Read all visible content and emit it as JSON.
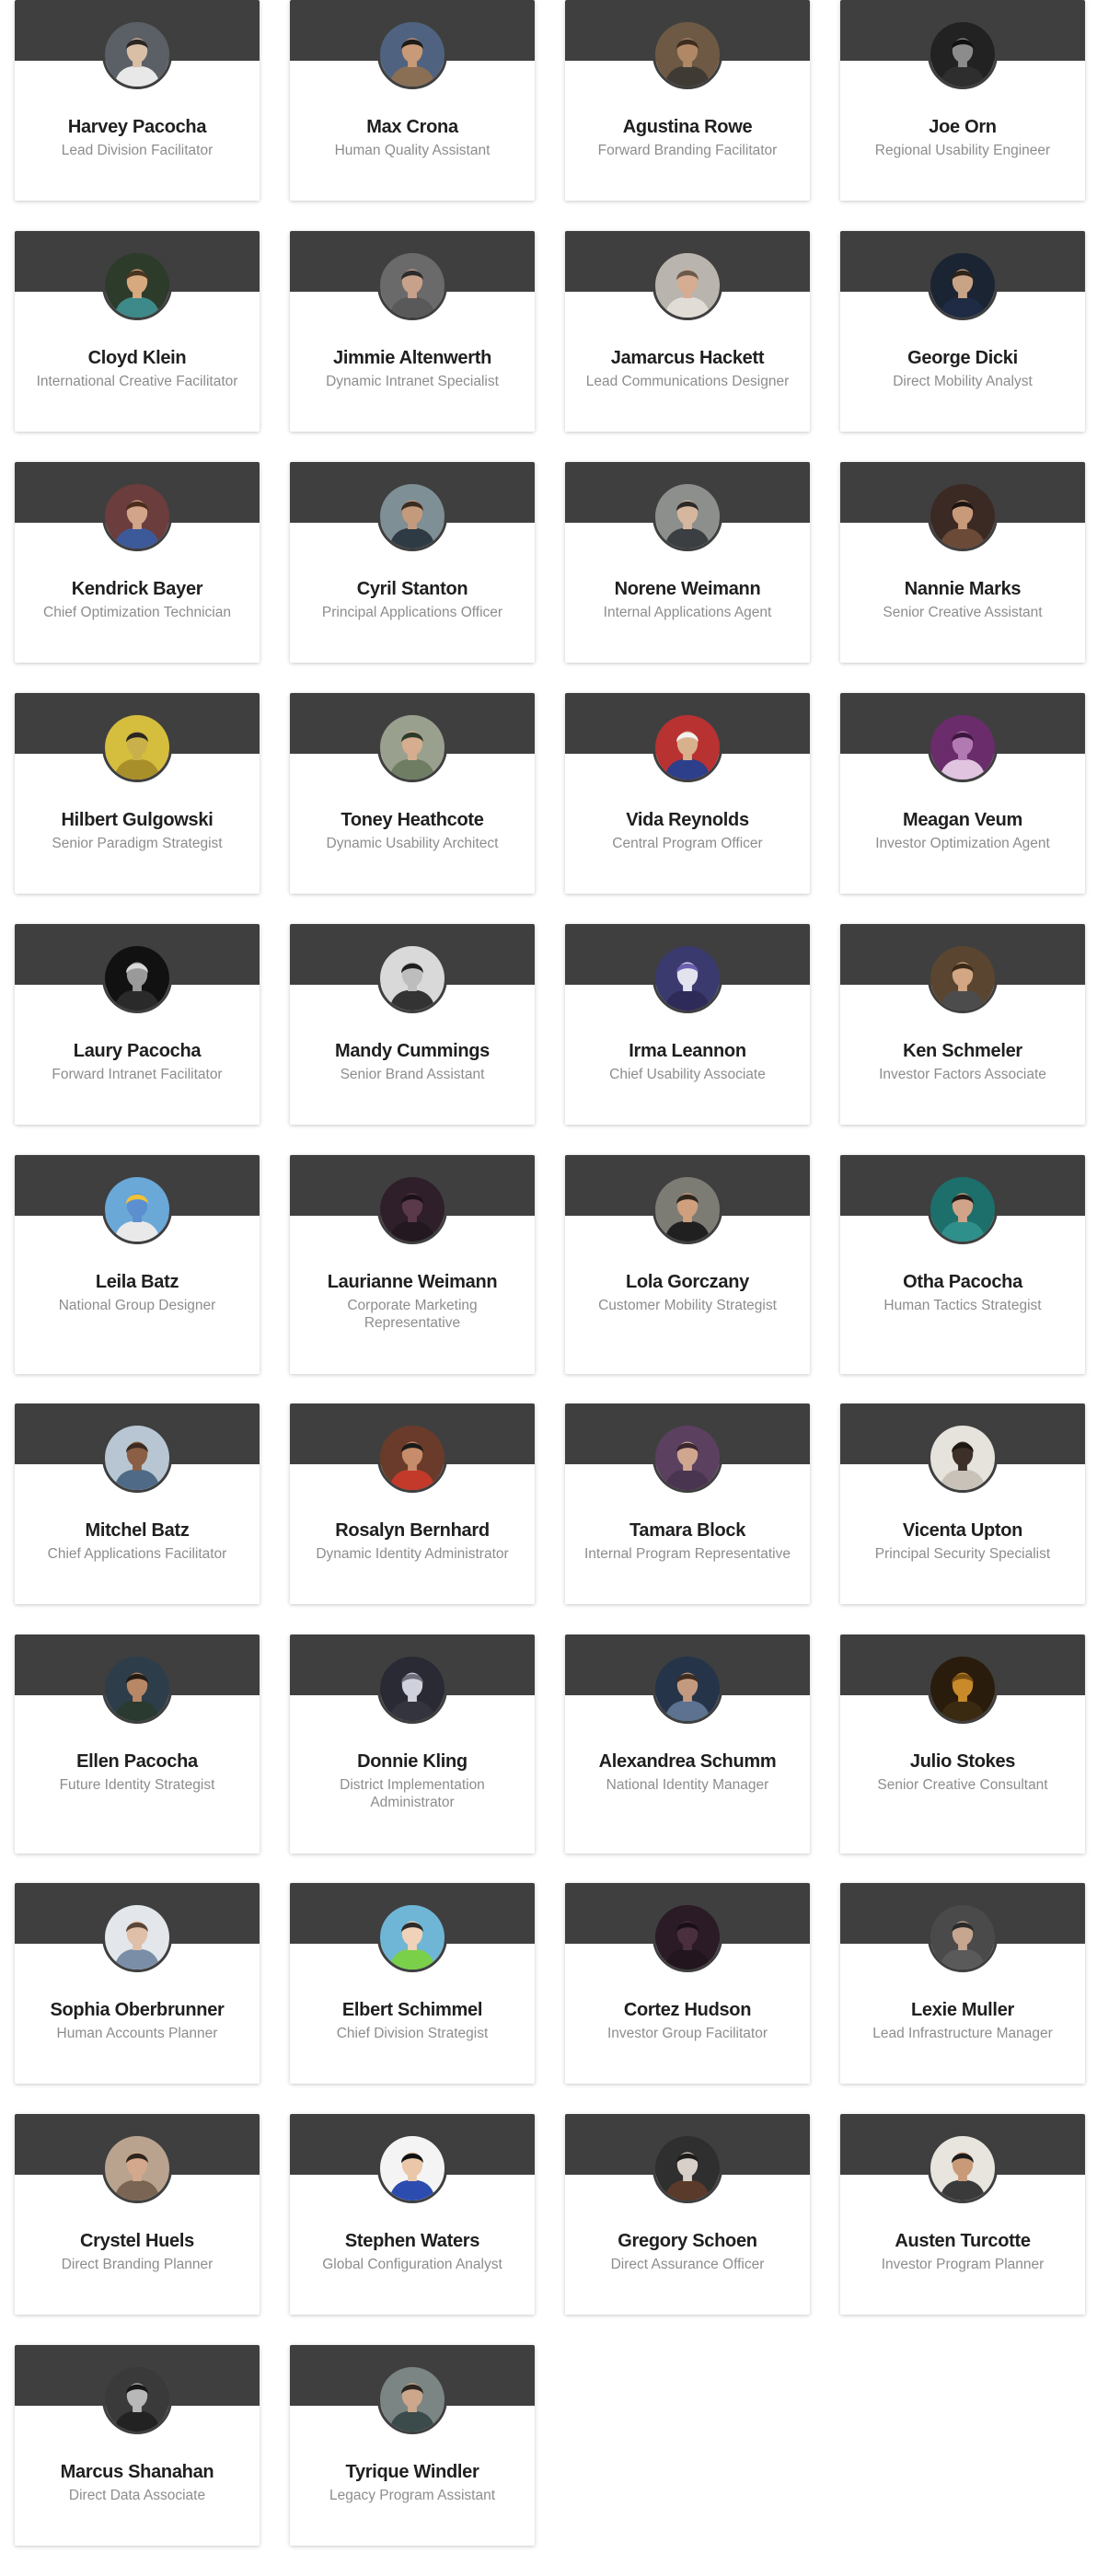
{
  "accent_colors": {
    "card_header": "#3f3f3f",
    "name_text": "#1f1f1f",
    "title_text": "#8d8d8d",
    "card_background": "#ffffff"
  },
  "people": [
    {
      "name": "Harvey Pacocha",
      "title": "Lead Division Facilitator",
      "avatar": {
        "bg": "#5b6066",
        "skin": "#d9bfa6",
        "hair": "#2a2523",
        "shirt": "#e8e8e8"
      }
    },
    {
      "name": "Max Crona",
      "title": "Human Quality Assistant",
      "avatar": {
        "bg": "#4f6380",
        "skin": "#c89a78",
        "hair": "#1d1a18",
        "shirt": "#8a6f55"
      }
    },
    {
      "name": "Agustina Rowe",
      "title": "Forward Branding Facilitator",
      "avatar": {
        "bg": "#6e5a44",
        "skin": "#b08866",
        "hair": "#3d2c1f",
        "shirt": "#403a34"
      }
    },
    {
      "name": "Joe Orn",
      "title": "Regional Usability Engineer",
      "avatar": {
        "bg": "#222222",
        "skin": "#8c8c8c",
        "hair": "#111111",
        "shirt": "#2e2e2e"
      }
    },
    {
      "name": "Cloyd Klein",
      "title": "International Creative Facilitator",
      "avatar": {
        "bg": "#2d3b2a",
        "skin": "#d7a97f",
        "hair": "#4a3422",
        "shirt": "#3e8a8a"
      }
    },
    {
      "name": "Jimmie Altenwerth",
      "title": "Dynamic Intranet Specialist",
      "avatar": {
        "bg": "#6a6a6a",
        "skin": "#c7a18a",
        "hair": "#2b2b2b",
        "shirt": "#595959"
      }
    },
    {
      "name": "Jamarcus Hackett",
      "title": "Lead Communications Designer",
      "avatar": {
        "bg": "#b9b4ad",
        "skin": "#d6ad92",
        "hair": "#6b5a4c",
        "shirt": "#e1dcd6"
      }
    },
    {
      "name": "George Dicki",
      "title": "Direct Mobility Analyst",
      "avatar": {
        "bg": "#1b2433",
        "skin": "#c9a386",
        "hair": "#2d2419",
        "shirt": "#1f2b44"
      }
    },
    {
      "name": "Kendrick Bayer",
      "title": "Chief Optimization Technician",
      "avatar": {
        "bg": "#6b3d3d",
        "skin": "#d2a48a",
        "hair": "#4a2d1c",
        "shirt": "#3c5a9a"
      }
    },
    {
      "name": "Cyril Stanton",
      "title": "Principal Applications Officer",
      "avatar": {
        "bg": "#7e8f95",
        "skin": "#c49a7c",
        "hair": "#3b2b21",
        "shirt": "#2f3b44"
      }
    },
    {
      "name": "Norene Weimann",
      "title": "Internal Applications Agent",
      "avatar": {
        "bg": "#8c8f8c",
        "skin": "#d6b69e",
        "hair": "#2c2a28",
        "shirt": "#3b3f42"
      }
    },
    {
      "name": "Nannie Marks",
      "title": "Senior Creative Assistant",
      "avatar": {
        "bg": "#3b2a24",
        "skin": "#c99a7a",
        "hair": "#1a1412",
        "shirt": "#6b4a38"
      }
    },
    {
      "name": "Hilbert Gulgowski",
      "title": "Senior Paradigm Strategist",
      "avatar": {
        "bg": "#d5bd3e",
        "skin": "#c9b04a",
        "hair": "#2a2620",
        "shirt": "#a98f2a"
      }
    },
    {
      "name": "Toney Heathcote",
      "title": "Dynamic Usability Architect",
      "avatar": {
        "bg": "#9aa08e",
        "skin": "#d6ad8f",
        "hair": "#2c3a2a",
        "shirt": "#6f7d63"
      }
    },
    {
      "name": "Vida Reynolds",
      "title": "Central Program Officer",
      "avatar": {
        "bg": "#b83232",
        "skin": "#d8b08c",
        "hair": "#f2f2f2",
        "shirt": "#2d3f8a"
      }
    },
    {
      "name": "Meagan Veum",
      "title": "Investor Optimization Agent",
      "avatar": {
        "bg": "#6a2c6a",
        "skin": "#b27ab2",
        "hair": "#3d163d",
        "shirt": "#e0c4e0"
      }
    },
    {
      "name": "Laury Pacocha",
      "title": "Forward Intranet Facilitator",
      "avatar": {
        "bg": "#111111",
        "skin": "#9a9a9a",
        "hair": "#d8d8d8",
        "shirt": "#2a2a2a"
      }
    },
    {
      "name": "Mandy Cummings",
      "title": "Senior Brand Assistant",
      "avatar": {
        "bg": "#d9d9d9",
        "skin": "#bdbdbd",
        "hair": "#1e1e1e",
        "shirt": "#333333"
      }
    },
    {
      "name": "Irma Leannon",
      "title": "Chief Usability Associate",
      "avatar": {
        "bg": "#3b3a6e",
        "skin": "#e3e3ef",
        "hair": "#6a5fb0",
        "shirt": "#2e2b58"
      }
    },
    {
      "name": "Ken Schmeler",
      "title": "Investor Factors Associate",
      "avatar": {
        "bg": "#5a4630",
        "skin": "#d3a784",
        "hair": "#3a2a1a",
        "shirt": "#4c4c4c"
      }
    },
    {
      "name": "Leila Batz",
      "title": "National Group Designer",
      "avatar": {
        "bg": "#6aa8d8",
        "skin": "#5b8fd0",
        "hair": "#f0c23a",
        "shirt": "#e9e9e9"
      }
    },
    {
      "name": "Laurianne Weimann",
      "title": "Corporate Marketing Representative",
      "avatar": {
        "bg": "#2e1f2a",
        "skin": "#5a3a4a",
        "hair": "#1b1218",
        "shirt": "#241820"
      }
    },
    {
      "name": "Lola Gorczany",
      "title": "Customer Mobility Strategist",
      "avatar": {
        "bg": "#7d7c74",
        "skin": "#cf9f7e",
        "hair": "#2d241d",
        "shirt": "#202020"
      }
    },
    {
      "name": "Otha Pacocha",
      "title": "Human Tactics Strategist",
      "avatar": {
        "bg": "#1c6f6a",
        "skin": "#d1a489",
        "hair": "#241b17",
        "shirt": "#2f8f8a"
      }
    },
    {
      "name": "Mitchel Batz",
      "title": "Chief Applications Facilitator",
      "avatar": {
        "bg": "#b7c6d2",
        "skin": "#8a5f45",
        "hair": "#3b2a20",
        "shirt": "#4e6a86"
      }
    },
    {
      "name": "Rosalyn Bernhard",
      "title": "Dynamic Identity Administrator",
      "avatar": {
        "bg": "#6a3b2a",
        "skin": "#c78c6a",
        "hair": "#1a1a1a",
        "shirt": "#c33a2b"
      }
    },
    {
      "name": "Tamara Block",
      "title": "Internal Program Representative",
      "avatar": {
        "bg": "#5b4060",
        "skin": "#d0a68f",
        "hair": "#3b2630",
        "shirt": "#4a3550"
      }
    },
    {
      "name": "Vicenta Upton",
      "title": "Principal Security Specialist",
      "avatar": {
        "bg": "#e6e2dc",
        "skin": "#3c3029",
        "hair": "#1e1712",
        "shirt": "#c9c2b8"
      }
    },
    {
      "name": "Ellen Pacocha",
      "title": "Future Identity Strategist",
      "avatar": {
        "bg": "#2d3d4a",
        "skin": "#b88866",
        "hair": "#241a13",
        "shirt": "#2a3a30"
      }
    },
    {
      "name": "Donnie Kling",
      "title": "District Implementation Administrator",
      "avatar": {
        "bg": "#2a2a35",
        "skin": "#cfd2dc",
        "hair": "#6d6d7c",
        "shirt": "#34343f"
      }
    },
    {
      "name": "Alexandrea Schumm",
      "title": "National Identity Manager",
      "avatar": {
        "bg": "#26344a",
        "skin": "#c39a80",
        "hair": "#3f2b1f",
        "shirt": "#5d7290"
      }
    },
    {
      "name": "Julio Stokes",
      "title": "Senior Creative Consultant",
      "avatar": {
        "bg": "#2a1c0c",
        "skin": "#c98b2a",
        "hair": "#7a4f12",
        "shirt": "#3b2a12"
      }
    },
    {
      "name": "Sophia Oberbrunner",
      "title": "Human Accounts Planner",
      "avatar": {
        "bg": "#e3e6ea",
        "skin": "#e0bfa8",
        "hair": "#5a4638",
        "shirt": "#7a8ea8"
      }
    },
    {
      "name": "Elbert Schimmel",
      "title": "Chief Division Strategist",
      "avatar": {
        "bg": "#6fb6d6",
        "skin": "#f0d2b8",
        "hair": "#2b2b2b",
        "shirt": "#7bd04a"
      }
    },
    {
      "name": "Cortez Hudson",
      "title": "Investor Group Facilitator",
      "avatar": {
        "bg": "#2a1b26",
        "skin": "#4a2f3e",
        "hair": "#1a1017",
        "shirt": "#22151d"
      }
    },
    {
      "name": "Lexie Muller",
      "title": "Lead Infrastructure Manager",
      "avatar": {
        "bg": "#4a4a4a",
        "skin": "#c7a690",
        "hair": "#2a2a2a",
        "shirt": "#5a5a5a"
      }
    },
    {
      "name": "Crystel Huels",
      "title": "Direct Branding Planner",
      "avatar": {
        "bg": "#b9a38f",
        "skin": "#d3a88c",
        "hair": "#2e241d",
        "shirt": "#7a6554"
      }
    },
    {
      "name": "Stephen Waters",
      "title": "Global Configuration Analyst",
      "avatar": {
        "bg": "#f4f4f4",
        "skin": "#e9c7a8",
        "hair": "#111111",
        "shirt": "#2c4cb0"
      }
    },
    {
      "name": "Gregory Schoen",
      "title": "Direct Assurance Officer",
      "avatar": {
        "bg": "#2f2f2f",
        "skin": "#d8d0c8",
        "hair": "#1b1b1b",
        "shirt": "#5a3a2a"
      }
    },
    {
      "name": "Austen Turcotte",
      "title": "Investor Program Planner",
      "avatar": {
        "bg": "#e8e4de",
        "skin": "#c99a78",
        "hair": "#1a1a1a",
        "shirt": "#3a3a3a"
      }
    },
    {
      "name": "Marcus Shanahan",
      "title": "Direct Data Associate",
      "avatar": {
        "bg": "#3a3a3a",
        "skin": "#b8b8b8",
        "hair": "#161616",
        "shirt": "#222222"
      }
    },
    {
      "name": "Tyrique Windler",
      "title": "Legacy Program Assistant",
      "avatar": {
        "bg": "#7a8584",
        "skin": "#cda78c",
        "hair": "#2b2620",
        "shirt": "#3b4a4a"
      }
    }
  ]
}
